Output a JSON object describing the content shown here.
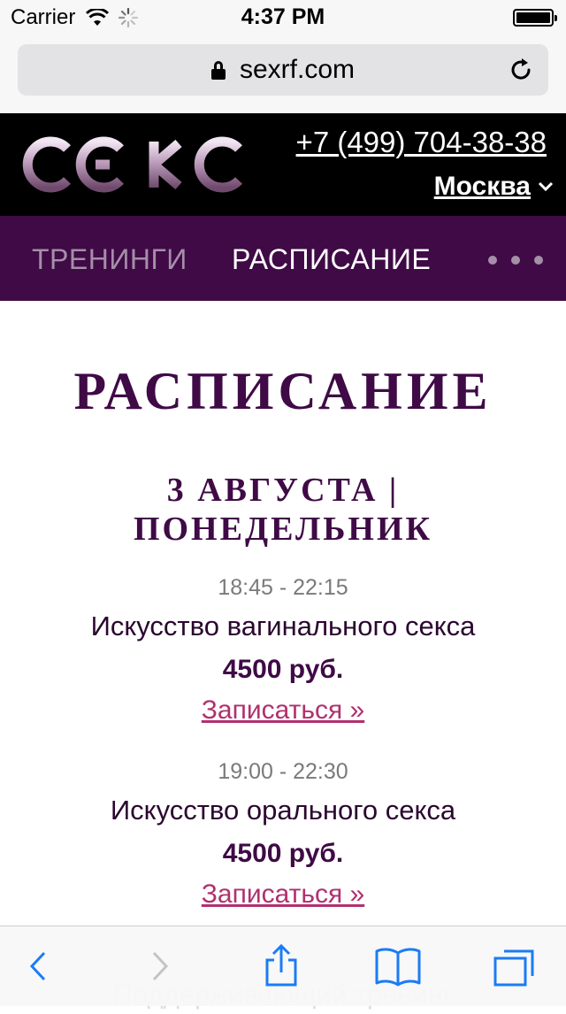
{
  "status_bar": {
    "carrier": "Carrier",
    "time": "4:37 PM"
  },
  "browser": {
    "url": "sexrf.com"
  },
  "header": {
    "logo_text": "СЕКС",
    "phone": "+7 (499) 704-38-38",
    "city": "Москва"
  },
  "nav": {
    "items": [
      {
        "label": "ТРЕНИНГИ",
        "active": false
      },
      {
        "label": "РАСПИСАНИЕ",
        "active": true
      }
    ]
  },
  "content": {
    "title": "РАСПИСАНИЕ",
    "day_heading_line1": "3 АВГУСТА |",
    "day_heading_line2": "ПОНЕДЕЛЬНИК",
    "events": [
      {
        "time": "18:45 - 22:15",
        "name": "Искусство вагинального секса",
        "price": "4500 руб.",
        "signup": "Записаться »"
      },
      {
        "time": "19:00 - 22:30",
        "name": "Искусство орального секса",
        "price": "4500 руб.",
        "signup": "Записаться »"
      },
      {
        "name": "Поддерживающий тренинг"
      }
    ]
  },
  "colors": {
    "brand": "#3f0a46",
    "link": "#b0316e",
    "ios_blue": "#1a7cf5"
  }
}
